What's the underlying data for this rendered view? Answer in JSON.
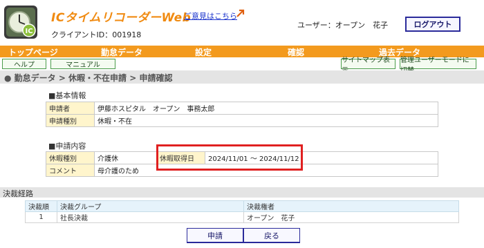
{
  "header": {
    "app_title": "ICタイムリコーダーWeb",
    "feedback_link": "ご意見はこちら",
    "client_id": "クライアントID：001918",
    "user": "ユーザー：オープン　花子",
    "logout": "ログアウト"
  },
  "topnav": {
    "items": [
      "トップページ",
      "勤怠データ",
      "設定",
      "確認",
      "過去データ"
    ]
  },
  "subnav": {
    "help": "ヘルプ",
    "manual": "マニュアル",
    "sitemap": "サイトマップ表示",
    "admin_mode": "管理ユーザーモードに切替"
  },
  "breadcrumb": "● 勤怠データ > 休暇・不在申請 > 申請確認",
  "basic_info": {
    "title": "■基本情報",
    "rows": [
      {
        "label": "申請者",
        "value": "伊藤ホスピタル　オープン　事務太郎"
      },
      {
        "label": "申請種別",
        "value": "休暇・不在"
      }
    ]
  },
  "application": {
    "title": "■申請内容",
    "leave_type_label": "休暇種別",
    "leave_type_value": "介護休",
    "leave_date_label": "休暇取得日",
    "leave_date_value": "2024/11/01 ～ 2024/11/12",
    "comment_label": "コメント",
    "comment_value": "母介護のため"
  },
  "route": {
    "title": "決裁経路",
    "headers": [
      "決裁順",
      "決裁グループ",
      "決裁権者"
    ],
    "rows": [
      {
        "order": "1",
        "group": "社長決裁",
        "approver": "オープン　花子"
      }
    ]
  },
  "actions": {
    "apply": "申請",
    "back": "戻る"
  },
  "colors": {
    "nav_orange": "#f39a1e",
    "title_orange": "#f08a10",
    "highlight_red": "#e02020",
    "label_yellow": "#fff5cc"
  }
}
